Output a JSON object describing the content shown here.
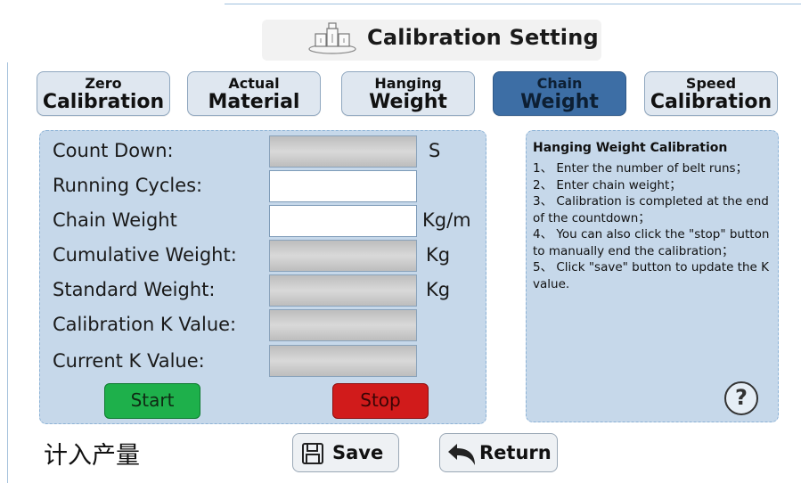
{
  "header": {
    "title": "Calibration Setting"
  },
  "tabs": [
    {
      "line1": "Zero",
      "line2": "Calibration",
      "active": false
    },
    {
      "line1": "Actual",
      "line2": "Material",
      "active": false
    },
    {
      "line1": "Hanging",
      "line2": "Weight",
      "active": false
    },
    {
      "line1": "Chain",
      "line2": "Weight",
      "active": true
    },
    {
      "line1": "Speed",
      "line2": "Calibration",
      "active": false
    }
  ],
  "form": {
    "count_down": {
      "label": "Count Down:",
      "value": "",
      "unit": "S"
    },
    "running_cycles": {
      "label": "Running Cycles:",
      "value": ""
    },
    "chain_weight": {
      "label": "Chain Weight",
      "value": "",
      "unit": "Kg/m"
    },
    "cumulative_weight": {
      "label": "Cumulative Weight:",
      "value": "",
      "unit": "Kg"
    },
    "standard_weight": {
      "label": "Standard Weight:",
      "value": "",
      "unit": "Kg"
    },
    "calibration_k": {
      "label": "Calibration K Value:",
      "value": ""
    },
    "current_k": {
      "label": "Current K Value:",
      "value": ""
    }
  },
  "buttons": {
    "start": "Start",
    "stop": "Stop",
    "save": "Save",
    "return": "Return"
  },
  "help": {
    "title": "Hanging Weight Calibration",
    "lines": [
      "1、 Enter the number of belt runs；",
      "2、 Enter chain weight；",
      "3、 Calibration is completed at the end of the countdown；",
      "4、 You can also click the \"stop\" button to manually end the calibration；",
      "5、 Click \"save\" button to update the K value."
    ],
    "icon": "question-circle-icon"
  },
  "footer": {
    "cn_label": "计入产量"
  },
  "colors": {
    "panel_bg": "#c6d8ea",
    "active_tab": "#3d6ea5",
    "start": "#1eb04b",
    "stop": "#d11b1b"
  }
}
